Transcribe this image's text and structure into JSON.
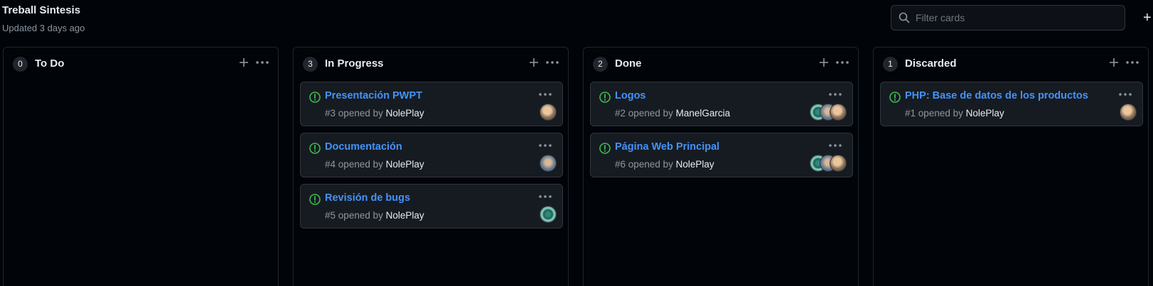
{
  "header": {
    "title": "Treball Sintesis",
    "updated": "Updated 3 days ago",
    "filter_placeholder": "Filter cards",
    "add_column_label": "+"
  },
  "colors": {
    "background": "#010409",
    "card": "#161b22",
    "link": "#4493f8",
    "open_issue": "#3fb950",
    "muted": "#8d96a0"
  },
  "columns": [
    {
      "name": "To Do",
      "count": "0",
      "cards": []
    },
    {
      "name": "In Progress",
      "count": "3",
      "cards": [
        {
          "title": "Presentación PWPT",
          "number": "#3",
          "opened_by": "opened by",
          "author": "NolePlay",
          "avatars": [
            "tan"
          ],
          "status_icon": "issue-opened-icon"
        },
        {
          "title": "Documentación",
          "number": "#4",
          "opened_by": "opened by",
          "author": "NolePlay",
          "avatars": [
            "blue"
          ],
          "status_icon": "issue-opened-icon"
        },
        {
          "title": "Revisión de bugs",
          "number": "#5",
          "opened_by": "opened by",
          "author": "NolePlay",
          "avatars": [
            "green"
          ],
          "status_icon": "issue-opened-icon"
        }
      ]
    },
    {
      "name": "Done",
      "count": "2",
      "cards": [
        {
          "title": "Logos",
          "number": "#2",
          "opened_by": "opened by",
          "author": "ManelGarcia",
          "avatars": [
            "green",
            "blue",
            "tan"
          ],
          "status_icon": "issue-opened-icon"
        },
        {
          "title": "Página Web Principal",
          "number": "#6",
          "opened_by": "opened by",
          "author": "NolePlay",
          "avatars": [
            "green",
            "blue",
            "tan"
          ],
          "status_icon": "issue-opened-icon"
        }
      ]
    },
    {
      "name": "Discarded",
      "count": "1",
      "cards": [
        {
          "title": "PHP: Base de datos de los productos",
          "number": "#1",
          "opened_by": "opened by",
          "author": "NolePlay",
          "avatars": [
            "tan"
          ],
          "status_icon": "issue-opened-icon"
        }
      ]
    }
  ]
}
